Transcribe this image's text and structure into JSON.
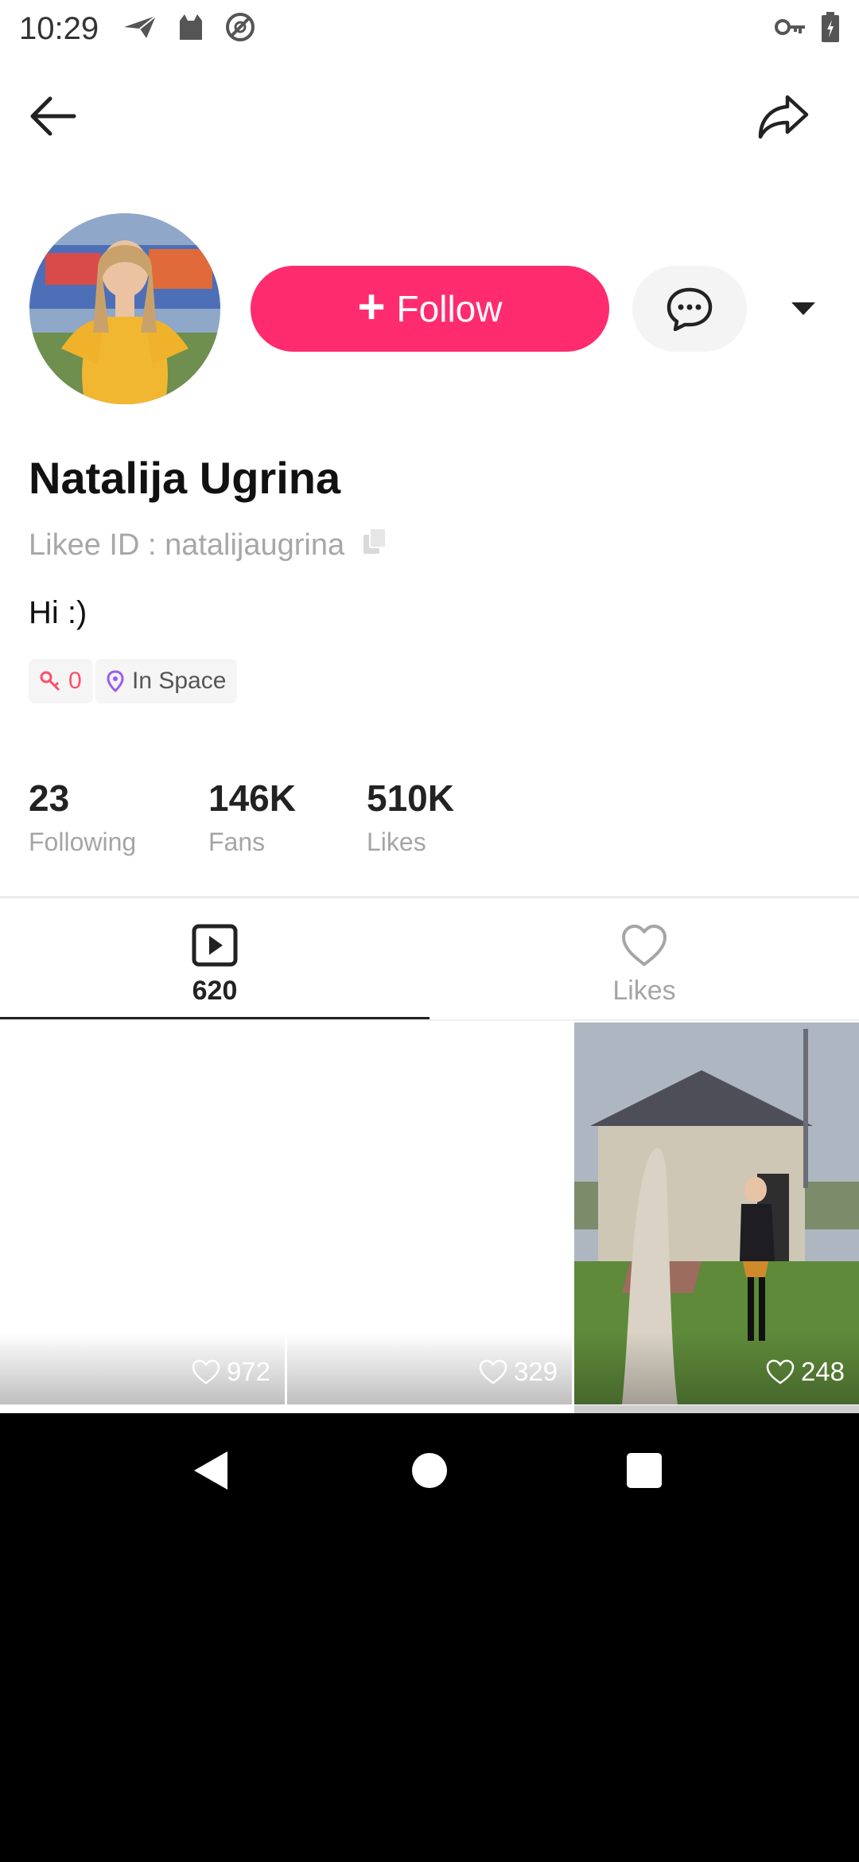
{
  "status_bar": {
    "time": "10:29",
    "left_icons": [
      "send-icon",
      "cat-icon",
      "no-signal-icon"
    ],
    "right_icons": [
      "vpn-key-icon",
      "battery-charging-icon"
    ]
  },
  "profile": {
    "name": "Natalija Ugrina",
    "id_label": "Likee ID : natalijaugrina",
    "bio": "Hi :)",
    "follow_label": "Follow",
    "follow_color": "#FE2C6E",
    "tags": {
      "key_count": "0",
      "location": "In Space"
    }
  },
  "stats": [
    {
      "value": "23",
      "label": "Following"
    },
    {
      "value": "146K",
      "label": "Fans"
    },
    {
      "value": "510K",
      "label": "Likes"
    }
  ],
  "tabs": [
    {
      "label": "620",
      "icon": "play-video-icon"
    },
    {
      "label": "Likes",
      "icon": "heart-outline-icon"
    }
  ],
  "videos": [
    {
      "likes": "972"
    },
    {
      "likes": "329"
    },
    {
      "likes": "248"
    }
  ]
}
